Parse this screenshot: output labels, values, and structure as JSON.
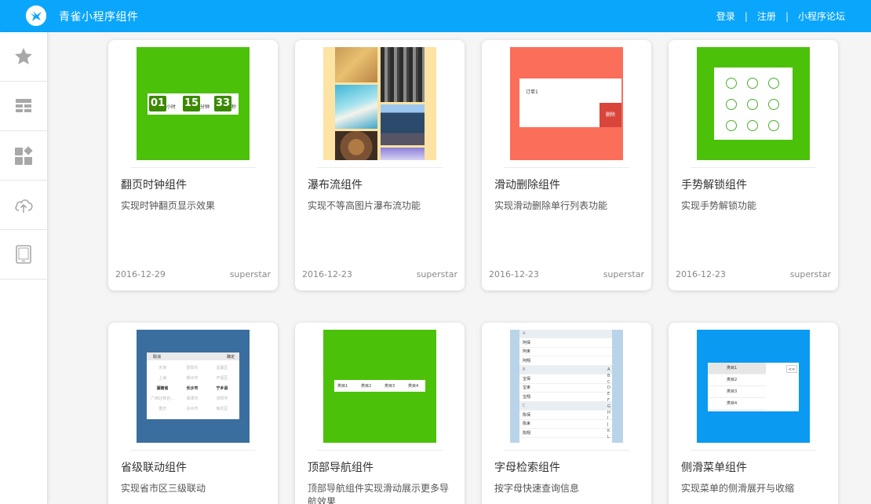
{
  "header": {
    "app_title": "青雀小程序组件",
    "links": [
      "登录",
      "注册",
      "小程序论坛"
    ],
    "separator": "|",
    "colors": {
      "bar": "#0aa6fb"
    }
  },
  "sidebar": {
    "items": [
      {
        "icon": "star-icon"
      },
      {
        "icon": "layout-icon"
      },
      {
        "icon": "components-icon"
      },
      {
        "icon": "cloud-upload-icon"
      },
      {
        "icon": "tablet-icon"
      }
    ]
  },
  "cards": [
    {
      "title": "翻页时钟组件",
      "desc": "实现时钟翻页显示效果",
      "date": "2016-12-29",
      "author": "superstar",
      "thumb": {
        "hours": "01",
        "h_unit": "小时",
        "minutes": "15",
        "m_unit": "分钟",
        "seconds": "33",
        "s_unit": "秒",
        "bg": "#4cc10a"
      }
    },
    {
      "title": "瀑布流组件",
      "desc": "实现不等高图片瀑布流功能",
      "date": "2016-12-23",
      "author": "superstar",
      "thumb": {
        "bg": "#fde3a4"
      }
    },
    {
      "title": "滑动删除组件",
      "desc": "实现滑动删除单行列表功能",
      "date": "2016-12-23",
      "author": "superstar",
      "thumb": {
        "label": "订单1",
        "delete": "删除",
        "bg": "#fb6e5a"
      }
    },
    {
      "title": "手势解锁组件",
      "desc": "实现手势解锁功能",
      "date": "2016-12-23",
      "author": "superstar",
      "thumb": {
        "bg": "#4cc10a"
      }
    },
    {
      "title": "省级联动组件",
      "desc": "实现省市区三级联动",
      "thumb": {
        "cancel": "取消",
        "confirm": "确定",
        "bg": "#3a6e9e",
        "rows": [
          [
            "天津",
            "邵阳市",
            "岳麓区"
          ],
          [
            "上海",
            "郴州市",
            "开福区"
          ],
          [
            "湖南省",
            "长沙市",
            "宁乡县"
          ],
          [
            "广西壮族自...",
            "湘潭市",
            "浏阳市"
          ],
          [
            "重庆",
            "永州市",
            "雨花区"
          ]
        ]
      }
    },
    {
      "title": "顶部导航组件",
      "desc": "顶部导航组件实现滑动展示更多导航效果",
      "thumb": {
        "tabs": [
          "类目1",
          "类目2",
          "类目3",
          "类目4"
        ],
        "bg": "#4cc10a"
      }
    },
    {
      "title": "字母检索组件",
      "desc": "按字母快速查询信息",
      "thumb": {
        "rows": [
          {
            "t": "A",
            "h": true
          },
          {
            "t": "阿保"
          },
          {
            "t": "阿束"
          },
          {
            "t": "阿翔"
          },
          {
            "t": "B",
            "h": true
          },
          {
            "t": "宝保"
          },
          {
            "t": "宝束"
          },
          {
            "t": "宝翔"
          },
          {
            "t": "C",
            "h": true
          },
          {
            "t": "陈保"
          },
          {
            "t": "陈束"
          },
          {
            "t": "陈翔"
          }
        ],
        "letters": [
          "A",
          "B",
          "C",
          "D",
          "E",
          "F",
          "G",
          "H",
          "I",
          "J",
          "K",
          "L"
        ]
      }
    },
    {
      "title": "侧滑菜单组件",
      "desc": "实现菜单的侧滑展开与收缩",
      "thumb": {
        "items": [
          "类目1",
          "类目2",
          "类目3",
          "类目4"
        ],
        "toggle": "<<",
        "bg": "#0a9af2"
      }
    }
  ]
}
